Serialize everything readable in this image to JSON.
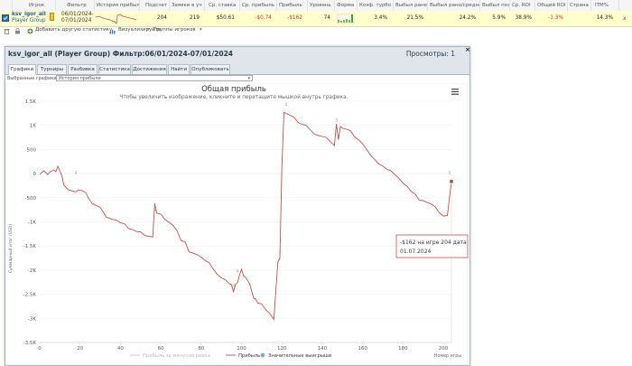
{
  "columns": [
    "Игрок",
    "Фильтр",
    "История прибыли",
    "Подсчет",
    "Заявки в уч",
    "Ср. ставка",
    "Ср. прибыль",
    "Прибыль",
    "Уровень",
    "Форма",
    "Коэф. турбо",
    "Выбыл ранее",
    "Выбыл рано/средне",
    "Выбыл поз",
    "Ср. ROI",
    "Общий ROI",
    "Страна",
    "ITM%"
  ],
  "row": {
    "player_line1": "ksv_igor_all",
    "player_line2": "Player Group",
    "filter_line1": "06/01/2024-",
    "filter_line2": "07/01/2024",
    "count": "204",
    "entries": "219",
    "avg_stake": "$50.61",
    "avg_profit": "-$0.74",
    "profit": "-$162",
    "level": "74",
    "turbo": "3.4%",
    "early": "21.5%",
    "early_mid": "24.2%",
    "late": "5.9%",
    "avg_roi": "38.9%",
    "total_roi": "-1.3%",
    "itm": "14.3%",
    "remove": "x"
  },
  "toolbar": {
    "add": "Добавить другую статистику",
    "visualize": "Визуализируйте",
    "groups": "Группы игроков"
  },
  "dialog": {
    "title": "ksv_igor_all (Player Group) Фильтр:06/01/2024-07/01/2024",
    "views": "Просмотры: 1",
    "close": "×",
    "tabs": [
      "Графики",
      "Турниры",
      "Разбивка",
      "Статистика",
      "Достижения",
      "Найти",
      "Опубликовать"
    ],
    "select_label": "Выбранные графики:",
    "select_value": "История прибыли"
  },
  "colors": {
    "line": "#c0504d",
    "accent": "#4a7fb5",
    "highlight_row": "#ffffcc"
  },
  "chart_data": {
    "type": "line",
    "title": "Общая прибыль",
    "subtitle": "Чтобы увеличить изображение, кликните и перетащите мышкой внутрь графика.",
    "ylabel": "Суммарный итог (USD)",
    "xlabel": "Номер игры",
    "xlim": [
      0,
      204
    ],
    "ylim": [
      -3500,
      1500
    ],
    "xticks": [
      "0",
      "20",
      "40",
      "60",
      "80",
      "100",
      "120",
      "140",
      "160",
      "180",
      "200"
    ],
    "yticks": [
      "1.5K",
      "1K",
      "500",
      "0",
      "-500",
      "-1K",
      "-1.5K",
      "-2K",
      "-2.5K",
      "-3K",
      "-3.5K"
    ],
    "series": [
      {
        "name": "Прибыль",
        "x": [
          0,
          2,
          4,
          5,
          7,
          8,
          9,
          11,
          12,
          14,
          16,
          18,
          19,
          21,
          23,
          24,
          26,
          28,
          30,
          33,
          36,
          38,
          40,
          42,
          44,
          46,
          48,
          50,
          52,
          54,
          56,
          57,
          58,
          60,
          62,
          64,
          66,
          68,
          70,
          72,
          74,
          76,
          78,
          80,
          82,
          84,
          86,
          88,
          90,
          92,
          94,
          95,
          96,
          97,
          98,
          99,
          100,
          101,
          102,
          104,
          106,
          107,
          108,
          110,
          112,
          114,
          116,
          118,
          119,
          120,
          121,
          122,
          124,
          126,
          128,
          130,
          132,
          134,
          136,
          138,
          140,
          142,
          144,
          146,
          147,
          148,
          149,
          150,
          152,
          154,
          156,
          158,
          160,
          162,
          164,
          166,
          168,
          170,
          172,
          174,
          176,
          178,
          180,
          182,
          184,
          186,
          188,
          190,
          192,
          194,
          196,
          198,
          200,
          202,
          204
        ],
        "y": [
          -20,
          60,
          -20,
          30,
          80,
          40,
          150,
          -50,
          -240,
          -330,
          -360,
          -380,
          -340,
          -350,
          -400,
          -500,
          -620,
          -660,
          -700,
          -900,
          -950,
          -960,
          -1020,
          -1040,
          -1140,
          -1160,
          -1200,
          -1210,
          -1280,
          -1300,
          -1310,
          -620,
          -820,
          -840,
          -950,
          -1010,
          -1070,
          -1180,
          -1390,
          -1410,
          -1620,
          -1650,
          -1680,
          -1730,
          -1800,
          -1850,
          -1980,
          -2090,
          -2160,
          -2200,
          -2280,
          -2300,
          -2450,
          -2300,
          -2260,
          -2100,
          -1980,
          -2120,
          -2150,
          -2280,
          -2580,
          -2600,
          -2680,
          -2700,
          -2820,
          -2900,
          -3020,
          -1830,
          -1750,
          130,
          1270,
          1250,
          1210,
          1170,
          1060,
          1020,
          1000,
          910,
          820,
          790,
          770,
          750,
          660,
          580,
          1030,
          700,
          980,
          940,
          920,
          890,
          760,
          700,
          620,
          500,
          380,
          290,
          200,
          160,
          90,
          60,
          -20,
          -100,
          -200,
          -260,
          -370,
          -420,
          -550,
          -560,
          -600,
          -630,
          -690,
          -810,
          -880,
          -870,
          -162
        ]
      }
    ],
    "point_labels": [
      {
        "x": 18,
        "y": -20,
        "text": "4"
      },
      {
        "x": 57,
        "y": -780,
        "text": "4"
      },
      {
        "x": 98,
        "y": -2060,
        "text": "4"
      },
      {
        "x": 96,
        "y": -2350,
        "text": "4"
      },
      {
        "x": 119,
        "y": -1650,
        "text": "3"
      },
      {
        "x": 122,
        "y": 1400,
        "text": "4"
      },
      {
        "x": 147,
        "y": 1070,
        "text": "3"
      },
      {
        "x": 203,
        "y": -20,
        "text": "3"
      }
    ],
    "tooltip": {
      "line1": "-$162 на игре 204 дата",
      "line2": "01.07.2024"
    },
    "legend": [
      "Прибыль за минусом рейка",
      "Прибыль",
      "Значительные выигрыши"
    ]
  }
}
